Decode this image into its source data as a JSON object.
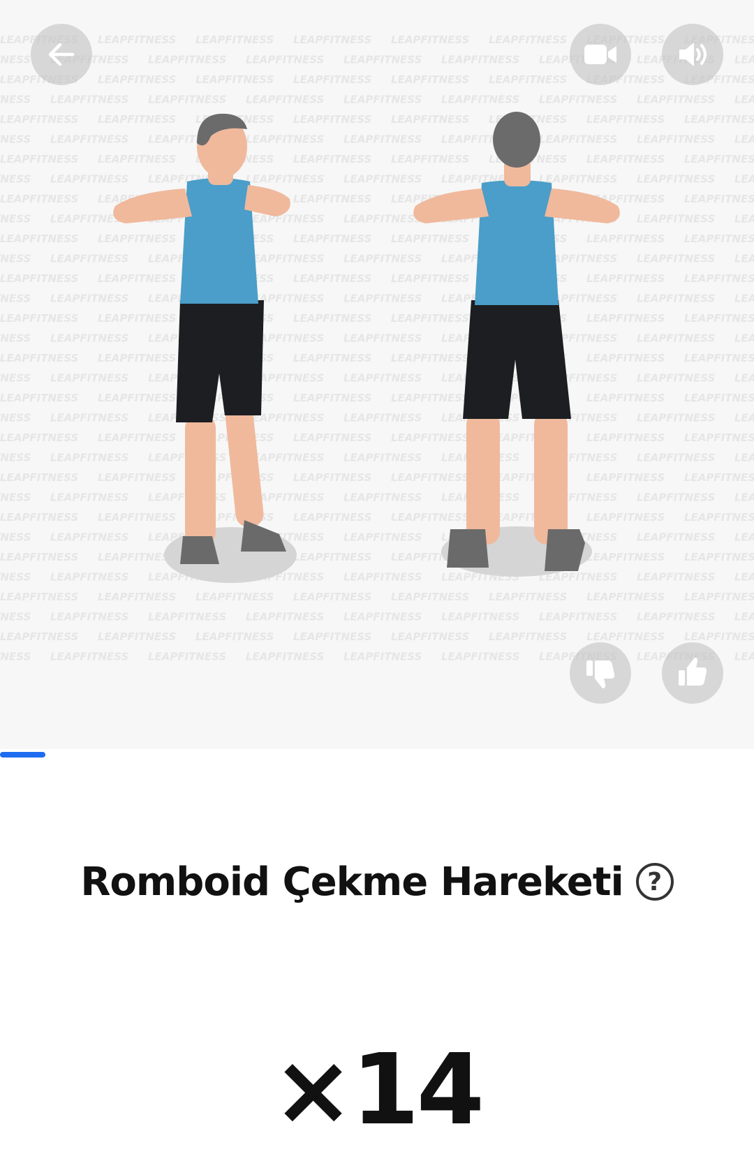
{
  "header": {
    "back_icon": "arrow-left-icon",
    "video_icon": "video-camera-icon",
    "sound_icon": "speaker-volume-icon"
  },
  "media": {
    "watermark_text": "LEAPFITNESS",
    "dislike_icon": "thumbs-down-icon",
    "like_icon": "thumbs-up-icon"
  },
  "progress": {
    "fraction": 0.06,
    "color": "#1e6cf0"
  },
  "exercise": {
    "title": "Romboid Çekme Hareketi",
    "help_icon": "question-circle-icon",
    "help_glyph": "?",
    "reps": "×14"
  },
  "colors": {
    "tank_top": "#4a9ec9",
    "shorts": "#1c1e22",
    "skin": "#f0b99c",
    "hair": "#6b6b6b",
    "shoes": "#6a6a6a"
  }
}
